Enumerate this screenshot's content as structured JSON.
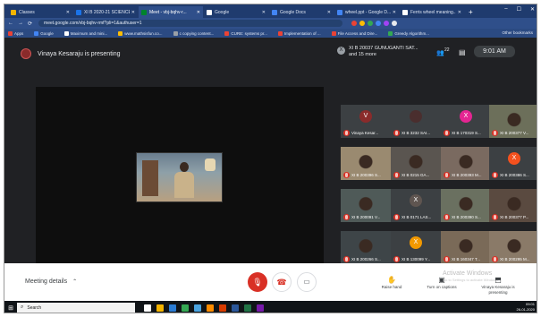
{
  "browser": {
    "tabs": [
      {
        "label": "Classes",
        "icon": "classroom-icon",
        "color": "#f4b400",
        "active": false
      },
      {
        "label": "XI B 2020-21 SCIENCE",
        "icon": "classroom-icon",
        "color": "#1a73e8",
        "active": false
      },
      {
        "label": "Meet - vbj-bqhv-r...",
        "icon": "meet-icon",
        "color": "#00832d",
        "active": true
      },
      {
        "label": "Google",
        "icon": "google-icon",
        "color": "#ffffff",
        "active": false
      },
      {
        "label": "Google Docs",
        "icon": "docs-icon",
        "color": "#4285f4",
        "active": false
      },
      {
        "label": "wheel.ppt - Google D...",
        "icon": "slides-icon",
        "color": "#4285f4",
        "active": false
      },
      {
        "label": "Ferris wheel meaning...",
        "icon": "google-icon",
        "color": "#ffffff",
        "active": false
      }
    ],
    "url": "meet.google.com/vbj-bqhv-rmf?pli=1&authuser=1",
    "bookmarks": [
      {
        "label": "Apps",
        "color": "#ea4335"
      },
      {
        "label": "Google",
        "color": "#4285f4"
      },
      {
        "label": "Maximum and mini...",
        "color": "#ffffff"
      },
      {
        "label": "www.mathsisfun.co...",
        "color": "#fbbc05"
      },
      {
        "label": "c copying content...",
        "color": "#9aa0a6"
      },
      {
        "label": "CURE: systems pr...",
        "color": "#ea4335"
      },
      {
        "label": "Implementation of ...",
        "color": "#ea4335"
      },
      {
        "label": "File Access and Dire...",
        "color": "#ea4335"
      },
      {
        "label": "Greedy Algorithm...",
        "color": "#34a853"
      }
    ],
    "other_bookmarks": "Other bookmarks"
  },
  "meet": {
    "presenter_text": "Vinaya Kesaraju is presenting",
    "notification": "XI B 20037 GUNUGANTI SAT... and 15 more",
    "notification_initial": "X",
    "people_count": "22",
    "time": "9:01 AM",
    "tiles": [
      {
        "name": "Vinaya Kesar...",
        "kind": "avatar",
        "avatar": "V",
        "color": "#8a2b2b"
      },
      {
        "name": "XI B 3232 SAI...",
        "kind": "avatar",
        "avatar": "",
        "color": "#4a2e2e"
      },
      {
        "name": "XI B 170319 S...",
        "kind": "avatar",
        "avatar": "X",
        "color": "#e52592"
      },
      {
        "name": "XI B 200377 V...",
        "kind": "video",
        "color": "#6c6f5a"
      },
      {
        "name": "XI B 200396 S...",
        "kind": "video",
        "color": "#9a8a70"
      },
      {
        "name": "XI B 0215 GA...",
        "kind": "video",
        "color": "#5a5550"
      },
      {
        "name": "XI B 200393 M...",
        "kind": "video",
        "color": "#7a6a60"
      },
      {
        "name": "XI B 200386 S...",
        "kind": "avatar",
        "avatar": "X",
        "color": "#f4511e"
      },
      {
        "name": "XI B 200091 V...",
        "kind": "video",
        "color": "#4f5a58"
      },
      {
        "name": "XI B 0171 LAS...",
        "kind": "avatar",
        "avatar": "X",
        "color": "#5f5550"
      },
      {
        "name": "XI B 200390 S...",
        "kind": "video",
        "color": "#6a7060"
      },
      {
        "name": "XI B 200377 P...",
        "kind": "video",
        "color": "#5a4a40"
      },
      {
        "name": "XI B 200266 S...",
        "kind": "video",
        "color": "#3e4548"
      },
      {
        "name": "XI B 130099 Y...",
        "kind": "avatar",
        "avatar": "X",
        "color": "#f29900"
      },
      {
        "name": "XI B 160347 T...",
        "kind": "video",
        "color": "#7a6a58"
      },
      {
        "name": "XI B 200295 M...",
        "kind": "video",
        "color": "#8a7a68"
      }
    ]
  },
  "controls": {
    "meeting_details": "Meeting details",
    "raise_hand": "Raise hand",
    "captions": "Turn on captions",
    "presenting": "Vinaya Kesaraju is presenting",
    "activate_title": "Activate Windows",
    "activate_sub": "Go to Settings to activate Windows."
  },
  "taskbar": {
    "search_placeholder": "Search",
    "time": "09:01",
    "date": "26-01-2020"
  }
}
